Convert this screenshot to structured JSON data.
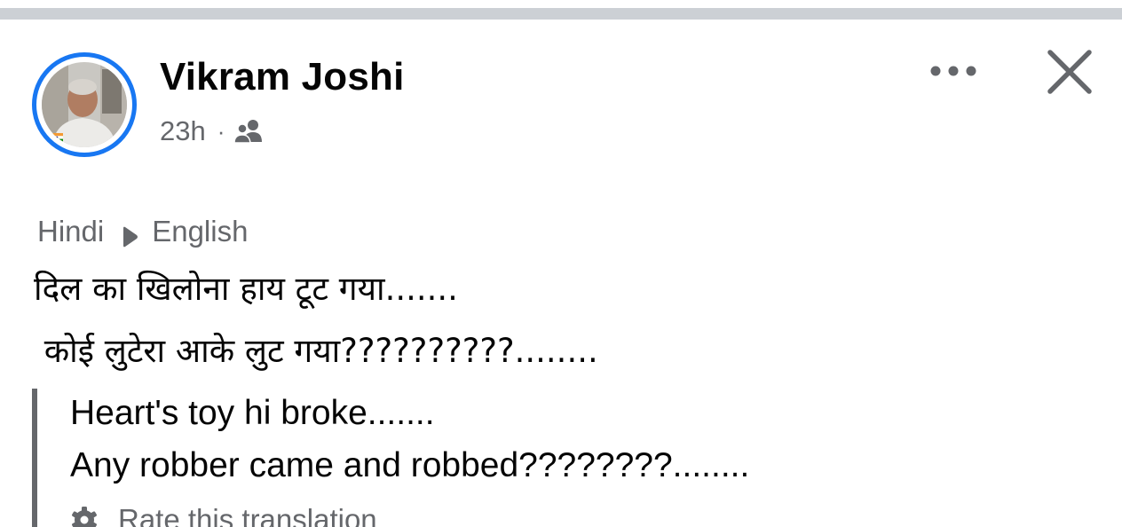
{
  "post": {
    "author": "Vikram Joshi",
    "time": "23h",
    "separator": "·",
    "audience_icon": "friends-icon",
    "more_icon": "more-horizontal-icon",
    "close_icon": "close-icon"
  },
  "translation": {
    "source_language": "Hindi",
    "target_language": "English",
    "original_lines": [
      "दिल का खिलोना हाय टूट गया.......",
      " कोई लुटेरा आके लुट गया??????????........"
    ],
    "translated_lines": [
      "Heart's toy hi broke.......",
      "Any robber came and robbed????????........"
    ],
    "rate_label": "Rate this translation",
    "rate_icon": "gear-icon"
  },
  "colors": {
    "accent": "#1877f2",
    "secondary_text": "#65676b",
    "primary_text": "#050505",
    "divider": "#ccd0d5"
  }
}
